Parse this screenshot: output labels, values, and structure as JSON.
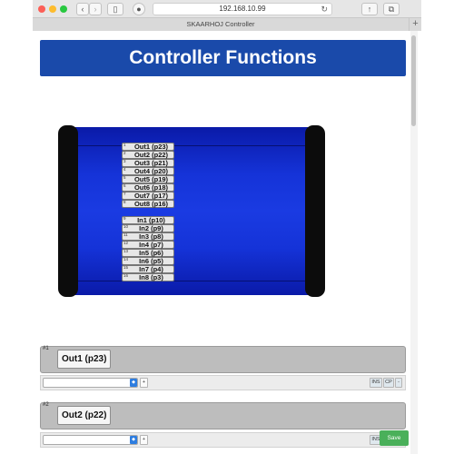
{
  "browser": {
    "url": "192.168.10.99",
    "tab_title": "SKAARHOJ Controller",
    "new_tab": "+"
  },
  "header": {
    "title": "Controller Functions"
  },
  "controller": {
    "outputs": [
      {
        "num": "1",
        "label": "Out1 (p23)"
      },
      {
        "num": "2",
        "label": "Out2 (p22)"
      },
      {
        "num": "3",
        "label": "Out3 (p21)"
      },
      {
        "num": "4",
        "label": "Out4 (p20)"
      },
      {
        "num": "5",
        "label": "Out5 (p19)"
      },
      {
        "num": "6",
        "label": "Out6 (p18)"
      },
      {
        "num": "7",
        "label": "Out7 (p17)"
      },
      {
        "num": "8",
        "label": "Out8 (p16)"
      }
    ],
    "inputs": [
      {
        "num": "9",
        "label": "In1 (p10)"
      },
      {
        "num": "10",
        "label": "In2 (p9)"
      },
      {
        "num": "11",
        "label": "In3 (p8)"
      },
      {
        "num": "12",
        "label": "In4 (p7)"
      },
      {
        "num": "13",
        "label": "In5 (p6)"
      },
      {
        "num": "14",
        "label": "In6 (p5)"
      },
      {
        "num": "15",
        "label": "In7 (p4)"
      },
      {
        "num": "16",
        "label": "In8 (p3)"
      }
    ]
  },
  "functions": [
    {
      "index": "#1",
      "title": "Out1 (p23)",
      "add": "+",
      "ins": "INS",
      "cp": "CP",
      "x": "-"
    },
    {
      "index": "#2",
      "title": "Out2 (p22)",
      "add": "+",
      "ins": "INS"
    }
  ],
  "save_label": "Save",
  "colors": {
    "header_blue": "#1a4aaa",
    "panel_blue": "#1533d8",
    "save_green": "#4ab05a"
  }
}
